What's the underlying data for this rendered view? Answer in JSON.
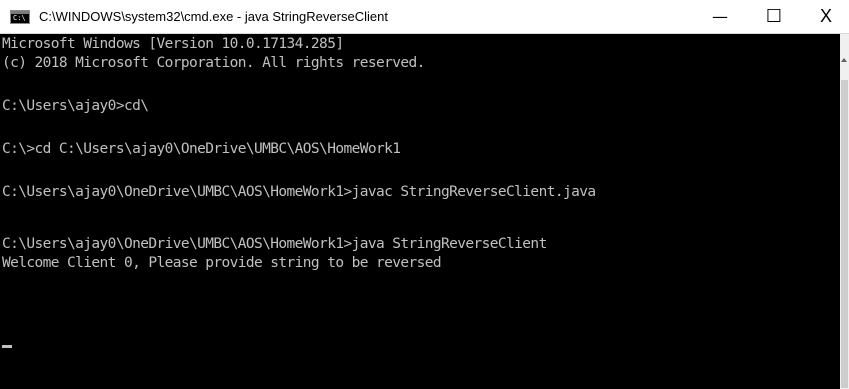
{
  "window": {
    "title": "C:\\WINDOWS\\system32\\cmd.exe - java  StringReverseClient",
    "app_icon_glyph": "C:\\",
    "controls": {
      "minimize": "—",
      "maximize": "☐",
      "close": "X"
    }
  },
  "console": {
    "lines": [
      "Microsoft Windows [Version 10.0.17134.285]",
      "(c) 2018 Microsoft Corporation. All rights reserved.",
      "C:\\Users\\ajay0>cd\\",
      "C:\\>cd C:\\Users\\ajay0\\OneDrive\\UMBC\\AOS\\HomeWork1",
      "C:\\Users\\ajay0\\OneDrive\\UMBC\\AOS\\HomeWork1>javac StringReverseClient.java",
      "C:\\Users\\ajay0\\OneDrive\\UMBC\\AOS\\HomeWork1>java StringReverseClient",
      "Welcome Client 0, Please provide string to be reversed"
    ]
  },
  "colors": {
    "console_bg": "#000000",
    "console_text": "#c0c0c0",
    "titlebar_bg": "#ffffff"
  }
}
